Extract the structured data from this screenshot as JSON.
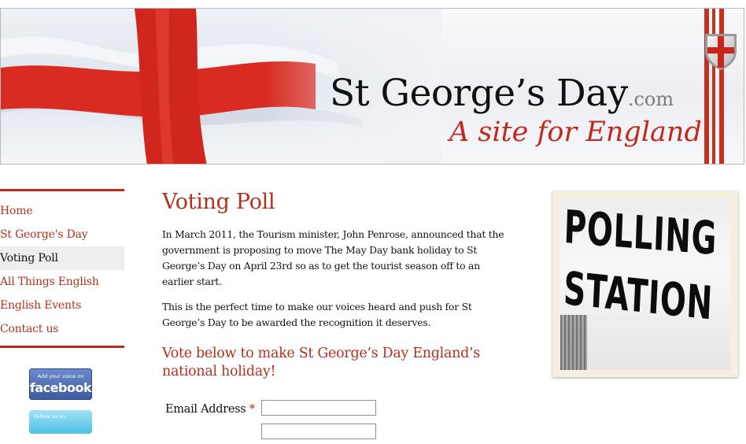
{
  "header": {
    "site_name": "St George’s Day",
    "site_suffix": ".com",
    "tagline": "A site for England",
    "accent_color": "#c0291b",
    "icons": [
      "flag-icon",
      "shield-icon"
    ]
  },
  "sidebar": {
    "nav": [
      {
        "label": "Home"
      },
      {
        "label": "St George's Day"
      },
      {
        "label": "Voting Poll",
        "active": true
      },
      {
        "label": "All Things English"
      },
      {
        "label": "English Events"
      },
      {
        "label": "Contact us"
      }
    ],
    "facebook": {
      "small": "Add your voice on",
      "big": "facebook"
    },
    "twitter": {
      "small": "Follow us on"
    }
  },
  "main": {
    "title": "Voting Poll",
    "paragraphs": [
      "In March 2011, the Tourism minister, John Penrose, announced that the government is proposing to move The May Day bank holiday to St George’s Day on April 23rd so as to get the tourist season off to an earlier start.",
      "This is the perfect time to make our voices heard and push for St George’s Day to be awarded the recognition it deserves."
    ],
    "cta": "Vote below to make St George’s Day England’s national holiday!",
    "form": {
      "email_label": "Email Address",
      "required_marker": "*"
    }
  },
  "photo": {
    "line1": "POLLING",
    "line2": "STATION"
  }
}
